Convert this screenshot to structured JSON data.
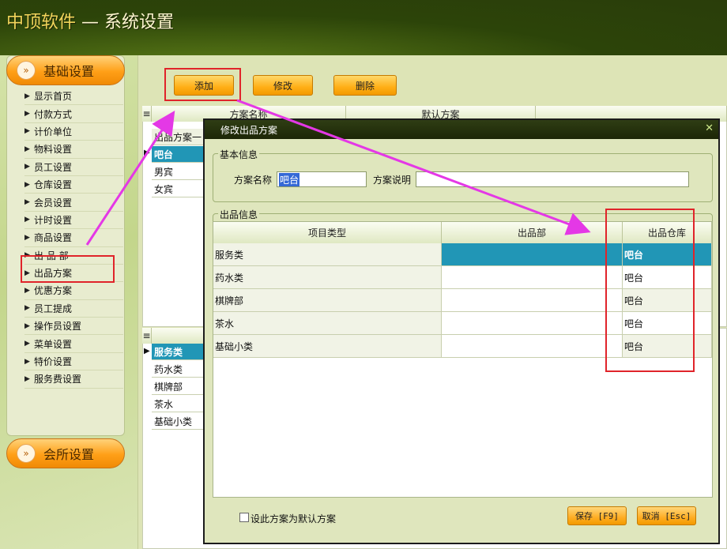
{
  "window": {
    "brand": "中顶软件",
    "separator": "—",
    "title": "系统设置"
  },
  "sidebar": {
    "section_basic": "基础设置",
    "items": [
      "显示首页",
      "付款方式",
      "计价单位",
      "物料设置",
      "员工设置",
      "仓库设置",
      "会员设置",
      "计时设置",
      "商品设置",
      "出 品 部",
      "出品方案",
      "优惠方案",
      "员工提成",
      "操作员设置",
      "菜单设置",
      "特价设置",
      "服务费设置"
    ],
    "section_club": "会所设置"
  },
  "toolbar": {
    "add": "添加",
    "edit": "修改",
    "delete": "删除"
  },
  "plan_grid": {
    "columns": [
      "方案名称",
      "默认方案"
    ],
    "partial_header": "出品方案一",
    "rows": [
      "吧台",
      "男宾",
      "女宾"
    ]
  },
  "category_grid": {
    "rows": [
      "服务类",
      "药水类",
      "棋牌部",
      "茶水",
      "基础小类"
    ]
  },
  "dialog": {
    "title": "修改出品方案",
    "basic_info": "基本信息",
    "plan_name_label": "方案名称",
    "plan_name_value": "吧台",
    "plan_desc_label": "方案说明",
    "plan_desc_value": "",
    "output_info": "出品信息",
    "columns": [
      "项目类型",
      "出品部",
      "出品仓库"
    ],
    "rows": [
      {
        "type": "服务类",
        "dept": "",
        "warehouse": "吧台"
      },
      {
        "type": "药水类",
        "dept": "",
        "warehouse": "吧台"
      },
      {
        "type": "棋牌部",
        "dept": "",
        "warehouse": "吧台"
      },
      {
        "type": "茶水",
        "dept": "",
        "warehouse": "吧台"
      },
      {
        "type": "基础小类",
        "dept": "",
        "warehouse": "吧台"
      }
    ],
    "default_checkbox": "设此方案为默认方案",
    "save": "保存 [F9]",
    "cancel": "取消 [Esc]"
  },
  "colors": {
    "accent_orange": "#ffae16",
    "selection": "#2196b6",
    "annotation": "#e0242a",
    "arrow": "#e438e6"
  }
}
